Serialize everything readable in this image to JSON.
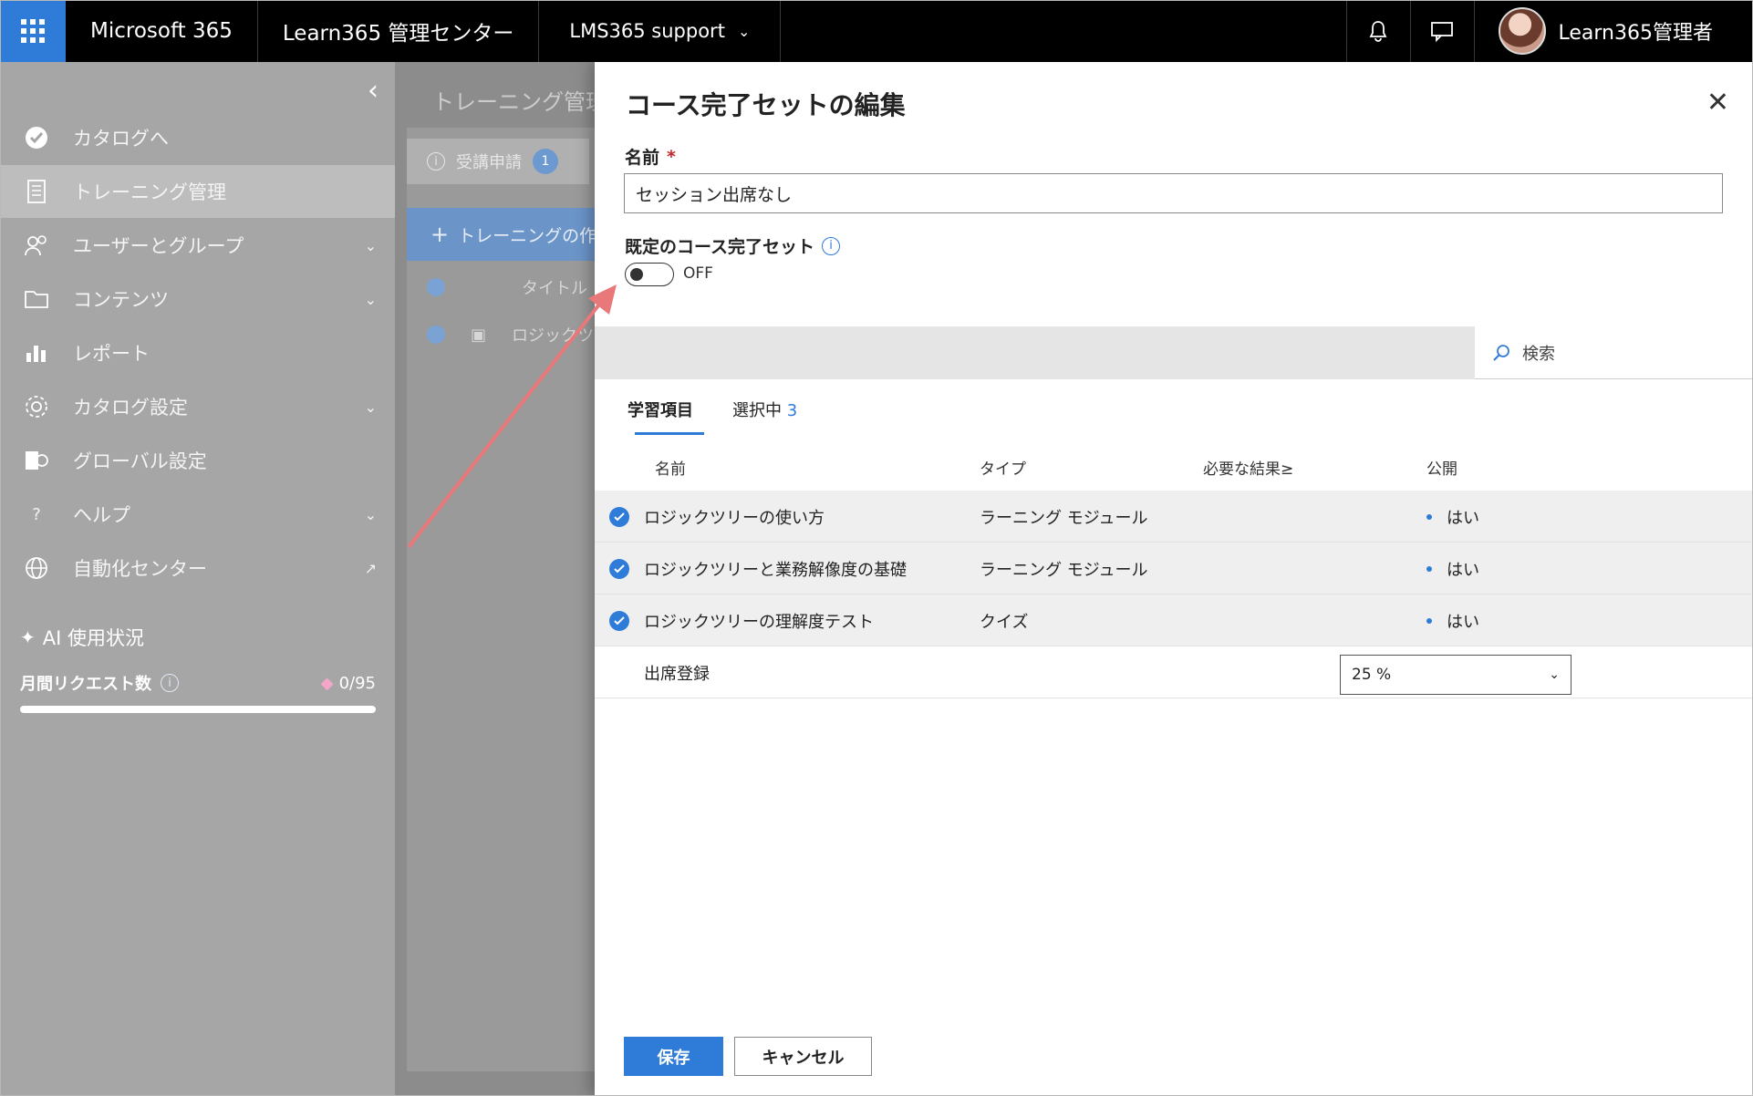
{
  "topbar": {
    "brand": "Microsoft 365",
    "app_title": "Learn365 管理センター",
    "site": "LMS365 support",
    "user_name": "Learn365管理者"
  },
  "sidebar": {
    "items": [
      {
        "label": "カタログへ",
        "icon": "catalog-check-icon"
      },
      {
        "label": "トレーニング管理",
        "icon": "training-doc-icon"
      },
      {
        "label": "ユーザーとグループ",
        "icon": "users-icon"
      },
      {
        "label": "コンテンツ",
        "icon": "folder-icon"
      },
      {
        "label": "レポート",
        "icon": "chart-icon"
      },
      {
        "label": "カタログ設定",
        "icon": "gear-icon"
      },
      {
        "label": "グローバル設定",
        "icon": "global-settings-icon"
      },
      {
        "label": "ヘルプ",
        "icon": "help-icon"
      },
      {
        "label": "自動化センター",
        "icon": "globe-icon"
      }
    ],
    "ai_title": "AI 使用状況",
    "monthly_requests_label": "月間リクエスト数",
    "monthly_requests_value": "0/95",
    "monthly_requests_fraction": 0
  },
  "background": {
    "page_title": "トレーニング管理",
    "tab_label": "受講申請",
    "tab_badge": "1",
    "create_button": "トレーニングの作成",
    "column_title": "タイトル",
    "row_title": "ロジックツリー"
  },
  "panel": {
    "title": "コース完了セットの編集",
    "name_label": "名前",
    "required_mark": "*",
    "name_value": "セッション出席なし",
    "default_label": "既定のコース完了セット",
    "toggle_state": "OFF",
    "search_placeholder": "検索",
    "tabs": [
      {
        "label": "学習項目"
      },
      {
        "label": "選択中",
        "count": "3"
      }
    ],
    "columns": [
      "名前",
      "タイプ",
      "必要な結果≥",
      "公開"
    ],
    "rows": [
      {
        "name": "ロジックツリーの使い方",
        "type": "ラーニング モジュール",
        "published": "はい"
      },
      {
        "name": "ロジックツリーと業務解像度の基礎",
        "type": "ラーニング モジュール",
        "published": "はい"
      },
      {
        "name": "ロジックツリーの理解度テスト",
        "type": "クイズ",
        "published": "はい"
      }
    ],
    "attendance": {
      "name": "出席登録",
      "required": "25 %"
    },
    "save_label": "保存",
    "cancel_label": "キャンセル"
  },
  "colors": {
    "accent": "#2f7bd8",
    "annotation_arrow": "#e8787a"
  }
}
